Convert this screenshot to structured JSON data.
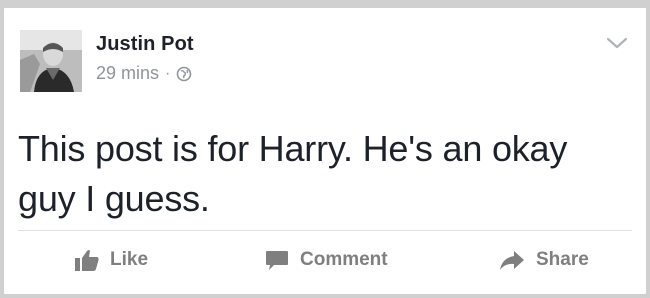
{
  "post": {
    "author": "Justin Pot",
    "time": "29 mins",
    "separator": "·",
    "privacy_icon": "globe-icon",
    "text": "This post is for Harry. He's an okay guy I guess.",
    "menu_icon": "chevron-down-icon"
  },
  "actions": {
    "like_label": "Like",
    "comment_label": "Comment",
    "share_label": "Share"
  },
  "colors": {
    "background": "#d0d0d0",
    "card": "#ffffff",
    "text": "#1d2129",
    "muted": "#90949c",
    "action": "#7f7f7f"
  }
}
